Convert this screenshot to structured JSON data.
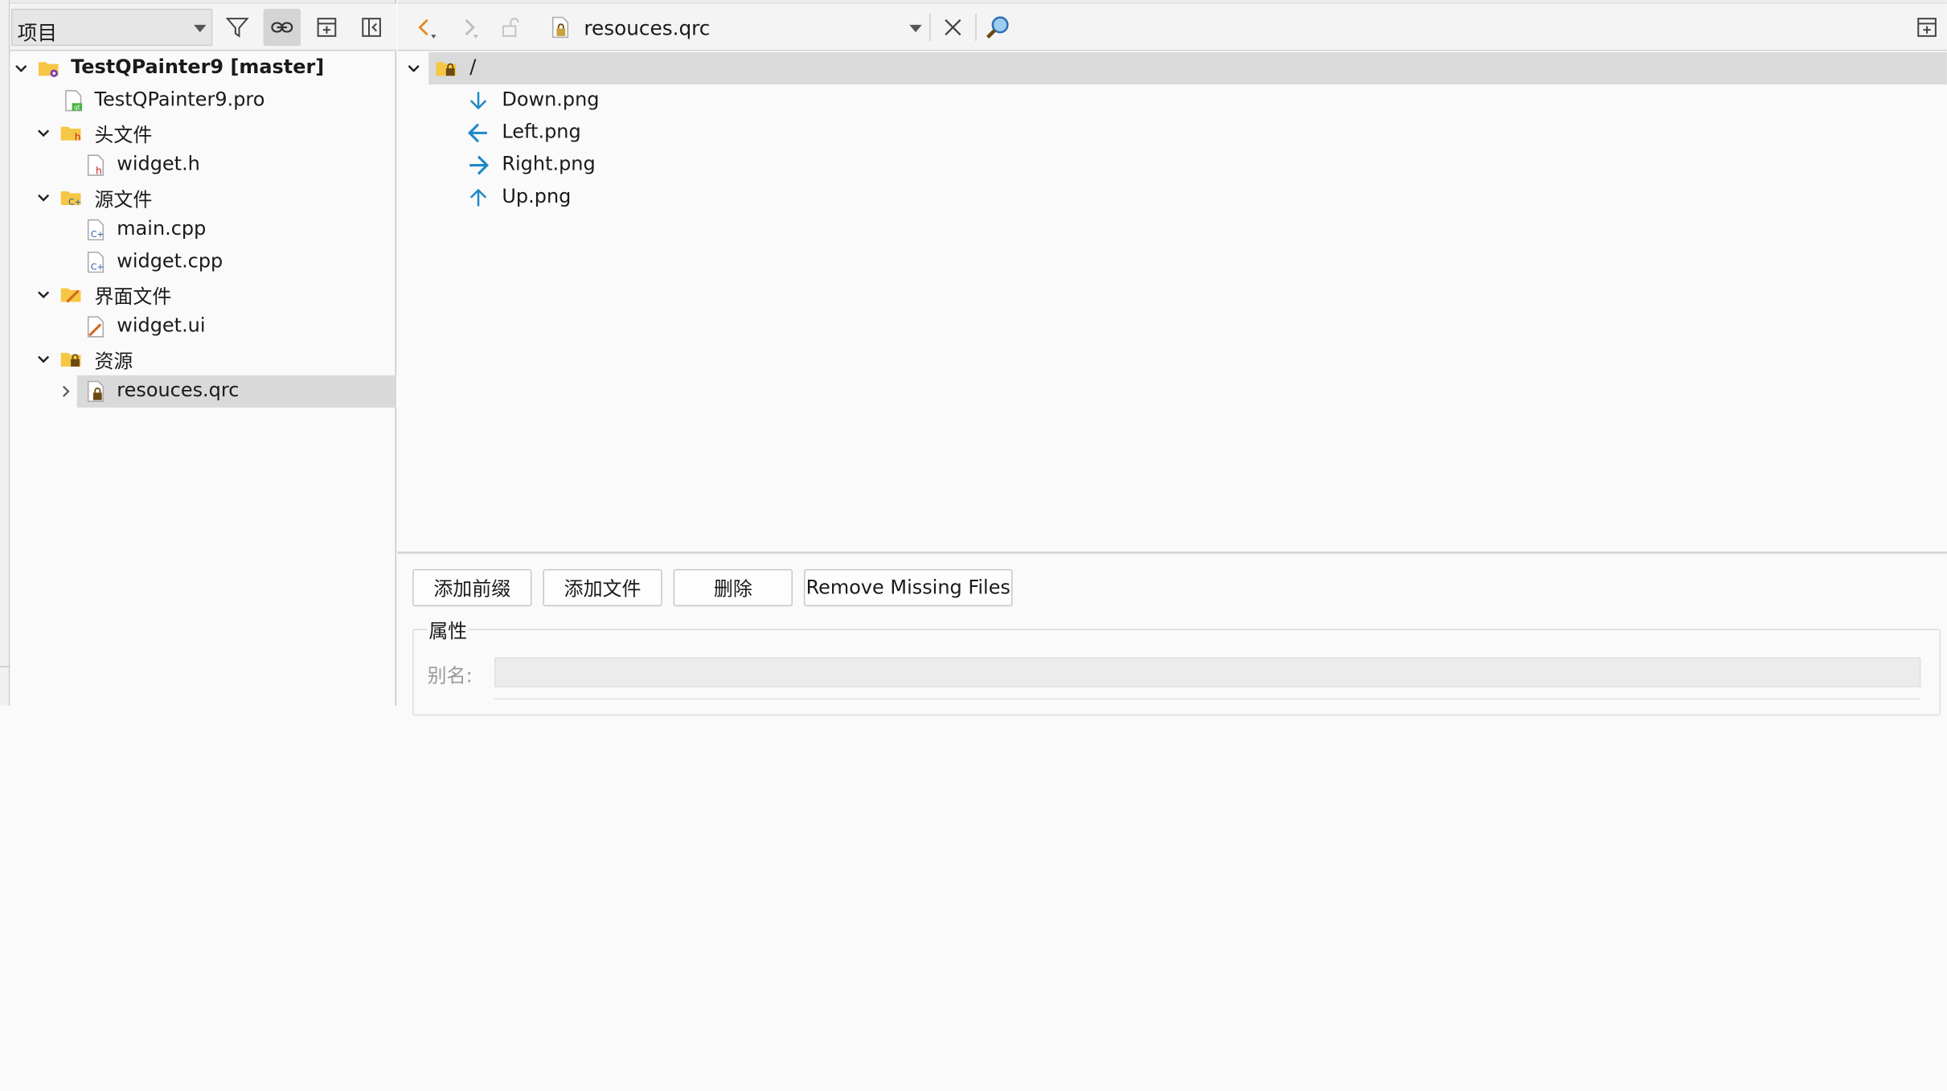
{
  "left_panel": {
    "view_selector": "项目",
    "toolbar_buttons": [
      "filter-icon",
      "link-icon",
      "add-split-icon",
      "collapse-sidebar-icon"
    ],
    "tree": {
      "project": "TestQPainter9 [master]",
      "pro_file": "TestQPainter9.pro",
      "headers_folder": "头文件",
      "header_file": "widget.h",
      "sources_folder": "源文件",
      "source_main": "main.cpp",
      "source_widget": "widget.cpp",
      "forms_folder": "界面文件",
      "form_file": "widget.ui",
      "resources_folder": "资源",
      "resource_file": "resouces.qrc"
    }
  },
  "editor": {
    "document_name": "resouces.qrc",
    "root_prefix": "/",
    "files": [
      {
        "name": "Down.png",
        "icon": "arrow-down-icon"
      },
      {
        "name": "Left.png",
        "icon": "arrow-left-icon"
      },
      {
        "name": "Right.png",
        "icon": "arrow-right-icon"
      },
      {
        "name": "Up.png",
        "icon": "arrow-up-icon"
      }
    ],
    "buttons": {
      "add_prefix": "添加前缀",
      "add_files": "添加文件",
      "remove": "删除",
      "remove_missing": "Remove Missing Files"
    },
    "properties": {
      "title": "属性",
      "alias_label": "别名:",
      "alias_value": ""
    }
  },
  "colors": {
    "accent_blue": "#1e88c7",
    "nav_orange": "#e08a1e",
    "folder_yellow": "#f6c744",
    "selection_gray": "#d9d9d9"
  }
}
